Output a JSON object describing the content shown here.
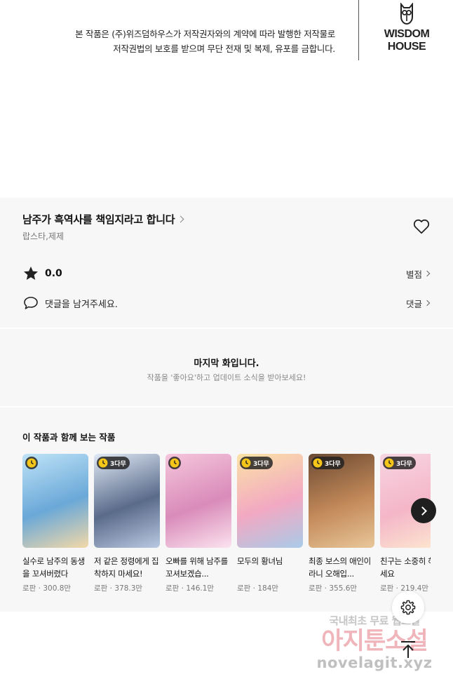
{
  "notice": {
    "line1": "본 작품은 (주)위즈덤하우스가 저작권자와의 계약에 따라 발행한 저작물로",
    "line2": "저작권법의 보호를 받으며 무단 전재 및 복제, 유포를 금합니다."
  },
  "logo": {
    "line1": "WISDOM",
    "line2": "HOUSE"
  },
  "work": {
    "title": "남주가 흑역사를 책임지라고 합니다",
    "author": "랍스타,제제"
  },
  "rating": {
    "value": "0.0",
    "link_label": "별점"
  },
  "comment": {
    "prompt": "댓글을 남겨주세요.",
    "link_label": "댓글"
  },
  "end_notice": {
    "title": "마지막 화입니다.",
    "subtitle": "작품을 '좋아요'하고 업데이트 소식을 받아보세요!"
  },
  "recommend": {
    "title": "이 작품과 함께 보는 작품",
    "items": [
      {
        "badge": "",
        "title": "실수로 남주의 동생을 꼬셔버렸다",
        "genre": "로판",
        "views": "300.8만",
        "colors": [
          "#bfe3f7",
          "#6aa8d8",
          "#f3d9a8"
        ]
      },
      {
        "badge": "3다무",
        "title": "저 같은 정령에게 집착하지 마세요!",
        "genre": "로판",
        "views": "378.3만",
        "colors": [
          "#dfe8f5",
          "#5a6b8a",
          "#b9c9e2"
        ]
      },
      {
        "badge": "",
        "title": "오빠를 위해 남주를 꼬셔보겠습...",
        "genre": "로판",
        "views": "146.1만",
        "colors": [
          "#f5c6dc",
          "#d98bb9",
          "#fbe3ef"
        ]
      },
      {
        "badge": "3다무",
        "title": "모두의 황녀님",
        "genre": "로판",
        "views": "184만",
        "colors": [
          "#fbe3a6",
          "#f2a8c2",
          "#a9cbe8"
        ]
      },
      {
        "badge": "3다무",
        "title": "최종 보스의 애인이라니 오해입...",
        "genre": "로판",
        "views": "355.6만",
        "colors": [
          "#6b4a32",
          "#c48a5a",
          "#e8c79a"
        ]
      },
      {
        "badge": "3다무",
        "title": "친구는 소중히 해 주세요",
        "genre": "로판",
        "views": "219.4만",
        "colors": [
          "#f7d5e2",
          "#f4b6c8",
          "#fde9d0"
        ]
      }
    ]
  },
  "watermark": {
    "line1": "국내최초 무료 웹소설",
    "line2": "아지툰소설",
    "line3": "novelagit.xyz"
  },
  "icons": {
    "heart": "heart-icon",
    "star": "star-icon",
    "comment": "comment-bubble-icon",
    "clock": "clock-icon",
    "next": "chevron-right-icon",
    "gear": "gear-icon",
    "top": "arrow-up-icon"
  }
}
